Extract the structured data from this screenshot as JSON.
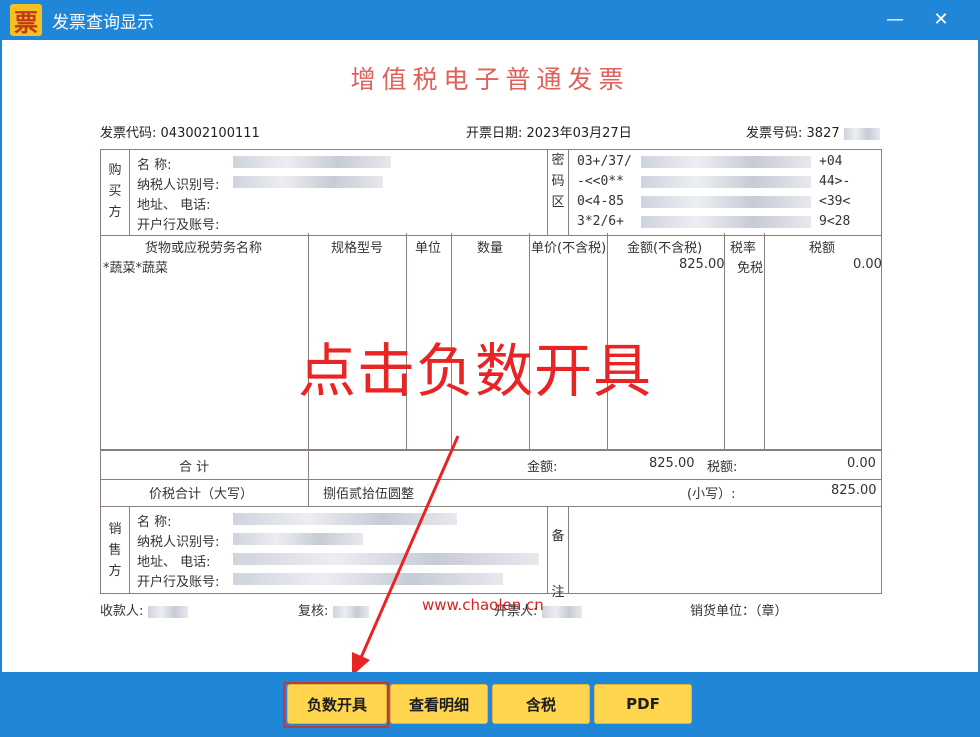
{
  "window": {
    "title": "发票查询显示",
    "icon_char": "票",
    "minimize": "—",
    "close": "✕"
  },
  "invoice": {
    "title": "增值税电子普通发票",
    "code_label": "发票代码:",
    "code": "043002100111",
    "date_label": "开票日期:",
    "date": "2023年03月27日",
    "number_label": "发票号码:",
    "number": "3827"
  },
  "buyer": {
    "side_label": "购买方",
    "name_label": "名            称:",
    "tax_id_label": "纳税人识别号:",
    "address_label": "地址、    电话:",
    "bank_label": "开户行及账号:",
    "cipher_label": "密码区",
    "cipher_lines": [
      "03+/37/",
      "-<<0**",
      "0<4-85",
      "3*2/6+"
    ],
    "cipher_tails": [
      "+04",
      "44>-",
      "<39<",
      "9<28"
    ]
  },
  "items": {
    "headers": [
      "货物或应税劳务名称",
      "规格型号",
      "单位",
      "数量",
      "单价(不含税)",
      "金额(不含税)",
      "税率",
      "税额"
    ],
    "rows": [
      {
        "name": "*蔬菜*蔬菜",
        "amount": "825.00",
        "rate": "免税",
        "tax": "0.00"
      }
    ]
  },
  "totals": {
    "total_label": "合      计",
    "amount_label": "金额:",
    "amount": "825.00",
    "tax_label": "税额:",
    "tax": "0.00",
    "grand_label": "价税合计（大写）",
    "grand_words": "捌佰贰拾伍圆整",
    "small_label": "(小写）:",
    "small": "825.00"
  },
  "seller": {
    "side_label": "销售方",
    "name_label": "名            称:",
    "tax_id_label": "纳税人识别号:",
    "address_label": "地址、    电话:",
    "bank_label": "开户行及账号:",
    "remark_label": "备注"
  },
  "footer": {
    "payee_label": "收款人:",
    "review_label": "复核:",
    "issuer_label": "开票人:",
    "seal_label": "销货单位：（章）"
  },
  "overlay": {
    "instruction": "点击负数开具",
    "website": "www.chaolen.cn"
  },
  "buttons": {
    "negative": "负数开具",
    "details": "查看明细",
    "tax_incl": "含税",
    "pdf": "PDF"
  },
  "colors": {
    "frame_blue": "#1f86d8",
    "button_yellow": "#ffd54d",
    "title_red": "#e0605a",
    "annotation_red": "#e82424"
  }
}
